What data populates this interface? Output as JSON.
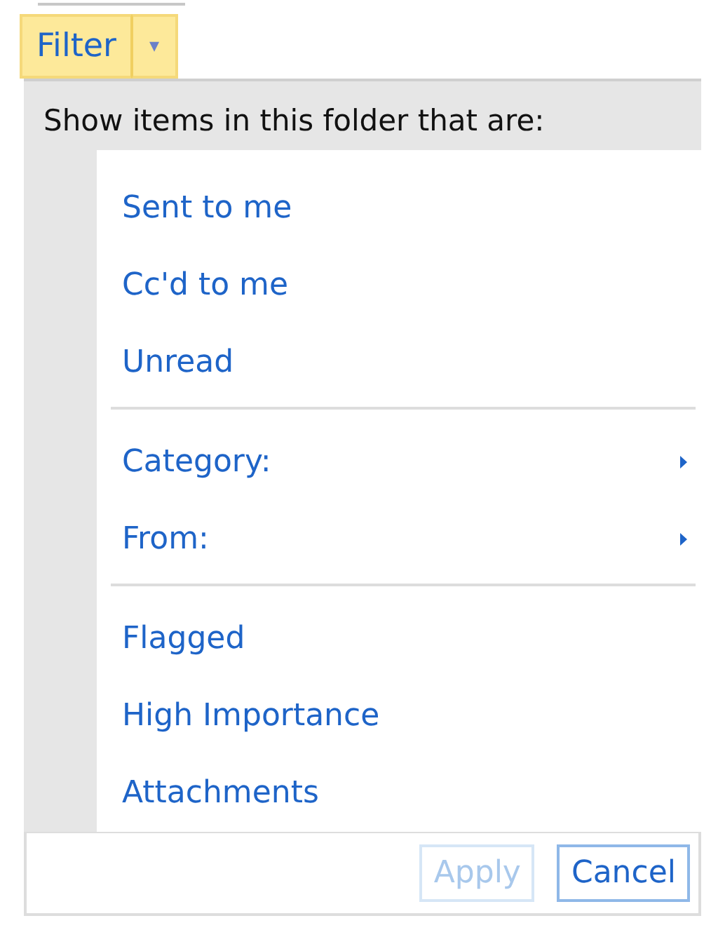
{
  "filter_button": {
    "label": "Filter",
    "caret": "▾"
  },
  "menu": {
    "header": "Show items in this folder that are:",
    "groups": [
      [
        {
          "label": "Sent to me",
          "kind": "option"
        },
        {
          "label": "Cc'd to me",
          "kind": "option"
        },
        {
          "label": "Unread",
          "kind": "option"
        }
      ],
      [
        {
          "label": "Category:",
          "kind": "submenu"
        },
        {
          "label": "From:",
          "kind": "submenu"
        }
      ],
      [
        {
          "label": "Flagged",
          "kind": "option"
        },
        {
          "label": "High Importance",
          "kind": "option"
        },
        {
          "label": "Attachments",
          "kind": "option"
        }
      ]
    ]
  },
  "buttons": [
    {
      "label": "Apply",
      "disabled": true
    },
    {
      "label": "Cancel",
      "disabled": false
    }
  ]
}
